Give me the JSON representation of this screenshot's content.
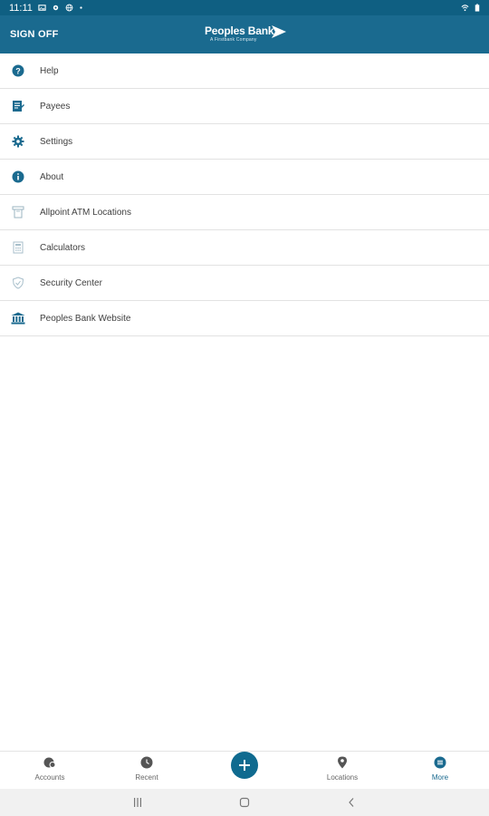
{
  "status_bar": {
    "time": "11:11"
  },
  "header": {
    "sign_off_label": "SIGN OFF",
    "logo_text": "Peoples Bank",
    "logo_subtext": "A Firstbank Company"
  },
  "menu": {
    "items": [
      {
        "label": "Help",
        "icon": "help-icon"
      },
      {
        "label": "Payees",
        "icon": "payees-icon"
      },
      {
        "label": "Settings",
        "icon": "gear-icon"
      },
      {
        "label": "About",
        "icon": "info-icon"
      },
      {
        "label": "Allpoint ATM Locations",
        "icon": "atm-icon"
      },
      {
        "label": "Calculators",
        "icon": "calculator-icon"
      },
      {
        "label": "Security Center",
        "icon": "shield-icon"
      },
      {
        "label": "Peoples Bank Website",
        "icon": "bank-icon"
      }
    ]
  },
  "bottom_nav": {
    "items": [
      {
        "label": "Accounts",
        "icon": "accounts-icon",
        "active": false
      },
      {
        "label": "Recent",
        "icon": "recent-icon",
        "active": false
      },
      {
        "label": "Locations",
        "icon": "location-pin-icon",
        "active": false
      },
      {
        "label": "More",
        "icon": "more-icon",
        "active": true
      }
    ],
    "fab_icon": "plus-icon"
  },
  "colors": {
    "primary": "#1a6a8f",
    "status_bar": "#0f5f82",
    "divider": "#e2e2e2"
  }
}
